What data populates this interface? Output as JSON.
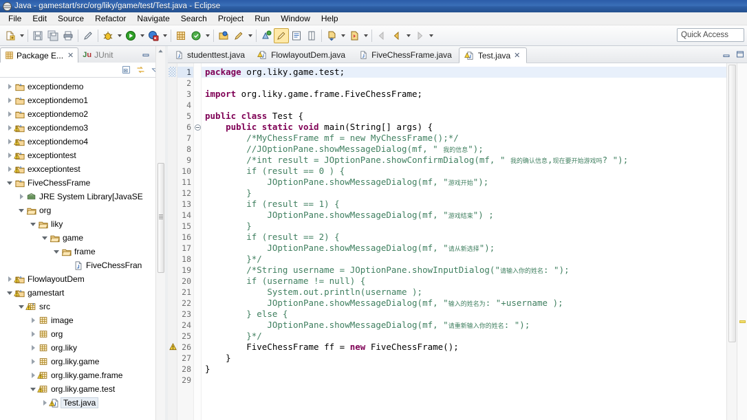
{
  "window": {
    "title": "Java - gamestart/src/org/liky/game/test/Test.java - Eclipse",
    "app_icon": "eclipse-icon"
  },
  "menubar": {
    "items": [
      {
        "label": "File"
      },
      {
        "label": "Edit"
      },
      {
        "label": "Source"
      },
      {
        "label": "Refactor"
      },
      {
        "label": "Navigate"
      },
      {
        "label": "Search"
      },
      {
        "label": "Project"
      },
      {
        "label": "Run"
      },
      {
        "label": "Window"
      },
      {
        "label": "Help"
      }
    ]
  },
  "toolbar": {
    "quick_access_placeholder": "Quick Access",
    "buttons": [
      {
        "name": "new-wizard",
        "icon": "new-file-icon"
      },
      {
        "name": "save",
        "icon": "save-icon"
      },
      {
        "name": "save-all",
        "icon": "save-all-icon"
      },
      {
        "name": "print",
        "icon": "print-icon"
      },
      {
        "name": "toggle-mark-occurrences",
        "icon": "pencil-icon"
      },
      {
        "name": "debug",
        "icon": "debug-bug-icon"
      },
      {
        "name": "run",
        "icon": "run-play-icon"
      },
      {
        "name": "external-tools",
        "icon": "external-tools-icon"
      },
      {
        "name": "new-java-package",
        "icon": "package-icon"
      },
      {
        "name": "new-java-class",
        "icon": "class-icon"
      },
      {
        "name": "open-type",
        "icon": "open-type-icon"
      },
      {
        "name": "search",
        "icon": "search-pencil-icon"
      },
      {
        "name": "next-annotation",
        "icon": "next-annotation-icon"
      },
      {
        "name": "previous-annotation",
        "icon": "prev-annotation-icon"
      },
      {
        "name": "last-edit-location",
        "icon": "last-edit-icon"
      },
      {
        "name": "back",
        "icon": "back-arrow-icon"
      },
      {
        "name": "forward",
        "icon": "forward-arrow-icon"
      }
    ]
  },
  "sidebar": {
    "tabs": [
      {
        "label": "Package E...",
        "active": true,
        "icon": "package-explorer-icon",
        "closable": true
      },
      {
        "label": "JUnit",
        "active": false,
        "icon": "junit-icon",
        "closable": false
      }
    ],
    "view_toolbar": [
      {
        "name": "collapse-all",
        "icon": "collapse-all-icon"
      },
      {
        "name": "link-with-editor",
        "icon": "link-with-editor-icon"
      },
      {
        "name": "view-menu",
        "icon": "view-menu-icon"
      }
    ],
    "window_buttons": [
      {
        "name": "minimize",
        "icon": "minimize-icon"
      },
      {
        "name": "maximize",
        "icon": "maximize-icon"
      }
    ],
    "tree": [
      {
        "label": "exceptiondemo",
        "indent": 0,
        "twisty": "closed",
        "icon": "java-project-icon",
        "warn": false,
        "selected": false
      },
      {
        "label": "exceptiondemo1",
        "indent": 0,
        "twisty": "closed",
        "icon": "java-project-icon",
        "warn": false,
        "selected": false
      },
      {
        "label": "exceptiondemo2",
        "indent": 0,
        "twisty": "closed",
        "icon": "java-project-icon",
        "warn": false,
        "selected": false
      },
      {
        "label": "exceptiondemo3",
        "indent": 0,
        "twisty": "closed",
        "icon": "java-project-icon",
        "warn": true,
        "selected": false
      },
      {
        "label": "exceptiondemo4",
        "indent": 0,
        "twisty": "closed",
        "icon": "java-project-icon",
        "warn": true,
        "selected": false
      },
      {
        "label": "exceptiontest",
        "indent": 0,
        "twisty": "closed",
        "icon": "java-project-icon",
        "warn": true,
        "selected": false
      },
      {
        "label": "exxceptiontest",
        "indent": 0,
        "twisty": "closed",
        "icon": "java-project-icon",
        "warn": true,
        "selected": false
      },
      {
        "label": "FiveChessFrame",
        "indent": 0,
        "twisty": "open",
        "icon": "java-project-icon",
        "warn": false,
        "selected": false
      },
      {
        "label": "JRE System Library",
        "suffix": " [JavaSE",
        "indent": 1,
        "twisty": "closed",
        "icon": "jre-library-icon",
        "warn": false,
        "selected": false
      },
      {
        "label": "org",
        "indent": 1,
        "twisty": "open",
        "icon": "folder-icon",
        "warn": false,
        "selected": false
      },
      {
        "label": "liky",
        "indent": 2,
        "twisty": "open",
        "icon": "folder-icon",
        "warn": false,
        "selected": false
      },
      {
        "label": "game",
        "indent": 3,
        "twisty": "open",
        "icon": "folder-icon",
        "warn": false,
        "selected": false
      },
      {
        "label": "frame",
        "indent": 4,
        "twisty": "open",
        "icon": "folder-icon",
        "warn": false,
        "selected": false
      },
      {
        "label": "FiveChessFran",
        "indent": 5,
        "twisty": "none",
        "icon": "java-file-icon",
        "warn": false,
        "selected": false
      },
      {
        "label": "FlowlayoutDem",
        "indent": 0,
        "twisty": "closed",
        "icon": "java-project-icon",
        "warn": true,
        "selected": false
      },
      {
        "label": "gamestart",
        "indent": 0,
        "twisty": "open",
        "icon": "java-project-icon",
        "warn": true,
        "selected": false
      },
      {
        "label": "src",
        "indent": 1,
        "twisty": "open",
        "icon": "source-folder-icon",
        "warn": true,
        "selected": false
      },
      {
        "label": "image",
        "indent": 2,
        "twisty": "closed",
        "icon": "package-icon",
        "warn": false,
        "selected": false
      },
      {
        "label": "org",
        "indent": 2,
        "twisty": "closed",
        "icon": "package-icon",
        "warn": false,
        "selected": false
      },
      {
        "label": "org.liky",
        "indent": 2,
        "twisty": "closed",
        "icon": "package-icon",
        "warn": false,
        "selected": false
      },
      {
        "label": "org.liky.game",
        "indent": 2,
        "twisty": "closed",
        "icon": "package-icon",
        "warn": false,
        "selected": false
      },
      {
        "label": "org.liky.game.frame",
        "indent": 2,
        "twisty": "closed",
        "icon": "package-icon",
        "warn": true,
        "selected": false
      },
      {
        "label": "org.liky.game.test",
        "indent": 2,
        "twisty": "open",
        "icon": "package-icon",
        "warn": true,
        "selected": false
      },
      {
        "label": "Test.java",
        "indent": 3,
        "twisty": "closed",
        "icon": "java-file-icon",
        "warn": true,
        "selected": true
      }
    ]
  },
  "editor": {
    "tabs": [
      {
        "label": "studenttest.java",
        "active": false,
        "icon": "java-file-icon",
        "closable": false
      },
      {
        "label": "FlowlayoutDem.java",
        "active": false,
        "icon": "java-file-warn-icon",
        "closable": false
      },
      {
        "label": "FiveChessFrame.java",
        "active": false,
        "icon": "java-file-icon",
        "closable": false
      },
      {
        "label": "Test.java",
        "active": true,
        "icon": "java-file-warn-icon",
        "closable": true
      }
    ],
    "window_buttons": [
      {
        "name": "minimize",
        "icon": "minimize-icon"
      },
      {
        "name": "maximize",
        "icon": "maximize-icon"
      }
    ],
    "current_line": 1,
    "fold_line": 6,
    "warning_line": 26,
    "lines": [
      {
        "n": 1,
        "tokens": [
          {
            "t": "kw",
            "v": "package"
          },
          {
            "t": "p",
            "v": " org.liky.game.test;"
          }
        ]
      },
      {
        "n": 2,
        "tokens": []
      },
      {
        "n": 3,
        "tokens": [
          {
            "t": "kw",
            "v": "import"
          },
          {
            "t": "p",
            "v": " org.liky.game.frame.FiveChessFrame;"
          }
        ]
      },
      {
        "n": 4,
        "tokens": []
      },
      {
        "n": 5,
        "tokens": [
          {
            "t": "kw",
            "v": "public class"
          },
          {
            "t": "p",
            "v": " Test {"
          }
        ]
      },
      {
        "n": 6,
        "tokens": [
          {
            "t": "p",
            "v": "    "
          },
          {
            "t": "kw",
            "v": "public static void"
          },
          {
            "t": "p",
            "v": " main(String[] args) {"
          }
        ]
      },
      {
        "n": 7,
        "tokens": [
          {
            "t": "p",
            "v": "        "
          },
          {
            "t": "cmt",
            "v": "/*MyChessFrame mf = new MyChessFrame();*/"
          }
        ]
      },
      {
        "n": 8,
        "tokens": [
          {
            "t": "p",
            "v": "        "
          },
          {
            "t": "cmt",
            "v": "//JOptionPane.showMessageDialog(mf, \" 我的信息\");"
          }
        ]
      },
      {
        "n": 9,
        "tokens": [
          {
            "t": "p",
            "v": "        "
          },
          {
            "t": "cmt",
            "v": "/*int result = JOptionPane.showConfirmDialog(mf, \" 我的确认信息,现在要开始游戏吗? \");"
          }
        ]
      },
      {
        "n": 10,
        "tokens": [
          {
            "t": "p",
            "v": "        "
          },
          {
            "t": "cmt",
            "v": "if (result == 0 ) {"
          }
        ]
      },
      {
        "n": 11,
        "tokens": [
          {
            "t": "p",
            "v": "            "
          },
          {
            "t": "cmt",
            "v": "JOptionPane.showMessageDialog(mf, \"游戏开始\");"
          }
        ]
      },
      {
        "n": 12,
        "tokens": [
          {
            "t": "p",
            "v": "        "
          },
          {
            "t": "cmt",
            "v": "}"
          }
        ]
      },
      {
        "n": 13,
        "tokens": [
          {
            "t": "p",
            "v": "        "
          },
          {
            "t": "cmt",
            "v": "if (result == 1) {"
          }
        ]
      },
      {
        "n": 14,
        "tokens": [
          {
            "t": "p",
            "v": "            "
          },
          {
            "t": "cmt",
            "v": "JOptionPane.showMessageDialog(mf, \"游戏结束\") ;"
          }
        ]
      },
      {
        "n": 15,
        "tokens": [
          {
            "t": "p",
            "v": "        "
          },
          {
            "t": "cmt",
            "v": "}"
          }
        ]
      },
      {
        "n": 16,
        "tokens": [
          {
            "t": "p",
            "v": "        "
          },
          {
            "t": "cmt",
            "v": "if (result == 2) {"
          }
        ]
      },
      {
        "n": 17,
        "tokens": [
          {
            "t": "p",
            "v": "            "
          },
          {
            "t": "cmt",
            "v": "JOptionPane.showMessageDialog(mf, \"请从新选择\");"
          }
        ]
      },
      {
        "n": 18,
        "tokens": [
          {
            "t": "p",
            "v": "        "
          },
          {
            "t": "cmt",
            "v": "}*/"
          }
        ]
      },
      {
        "n": 19,
        "tokens": [
          {
            "t": "p",
            "v": "        "
          },
          {
            "t": "cmt",
            "v": "/*String username = JOptionPane.showInputDialog(\"请输入你的姓名: \");"
          }
        ]
      },
      {
        "n": 20,
        "tokens": [
          {
            "t": "p",
            "v": "        "
          },
          {
            "t": "cmt",
            "v": "if (username != null) {"
          }
        ]
      },
      {
        "n": 21,
        "tokens": [
          {
            "t": "p",
            "v": "            "
          },
          {
            "t": "cmt",
            "v": "System.out.println(username );"
          }
        ]
      },
      {
        "n": 22,
        "tokens": [
          {
            "t": "p",
            "v": "            "
          },
          {
            "t": "cmt",
            "v": "JOptionPane.showMessageDialog(mf, \"输入的姓名为: \"+username );"
          }
        ]
      },
      {
        "n": 23,
        "tokens": [
          {
            "t": "p",
            "v": "        "
          },
          {
            "t": "cmt",
            "v": "} else {"
          }
        ]
      },
      {
        "n": 24,
        "tokens": [
          {
            "t": "p",
            "v": "            "
          },
          {
            "t": "cmt",
            "v": "JOptionPane.showMessageDialog(mf, \"请重新输入你的姓名: \");"
          }
        ]
      },
      {
        "n": 25,
        "tokens": [
          {
            "t": "p",
            "v": "        "
          },
          {
            "t": "cmt",
            "v": "}*/"
          }
        ]
      },
      {
        "n": 26,
        "tokens": [
          {
            "t": "p",
            "v": "        FiveChessFrame ff = "
          },
          {
            "t": "kw",
            "v": "new"
          },
          {
            "t": "p",
            "v": " FiveChessFrame();"
          }
        ]
      },
      {
        "n": 27,
        "tokens": [
          {
            "t": "p",
            "v": "    }"
          }
        ]
      },
      {
        "n": 28,
        "tokens": [
          {
            "t": "p",
            "v": "}"
          }
        ]
      },
      {
        "n": 29,
        "tokens": []
      }
    ]
  },
  "colors": {
    "title_bar": "#2b5ca8",
    "keyword": "#7f0055",
    "comment": "#3f7f5f",
    "string": "#2a00ff",
    "current_line": "#e8f0fb",
    "warning_marker": "#f2df6e"
  }
}
